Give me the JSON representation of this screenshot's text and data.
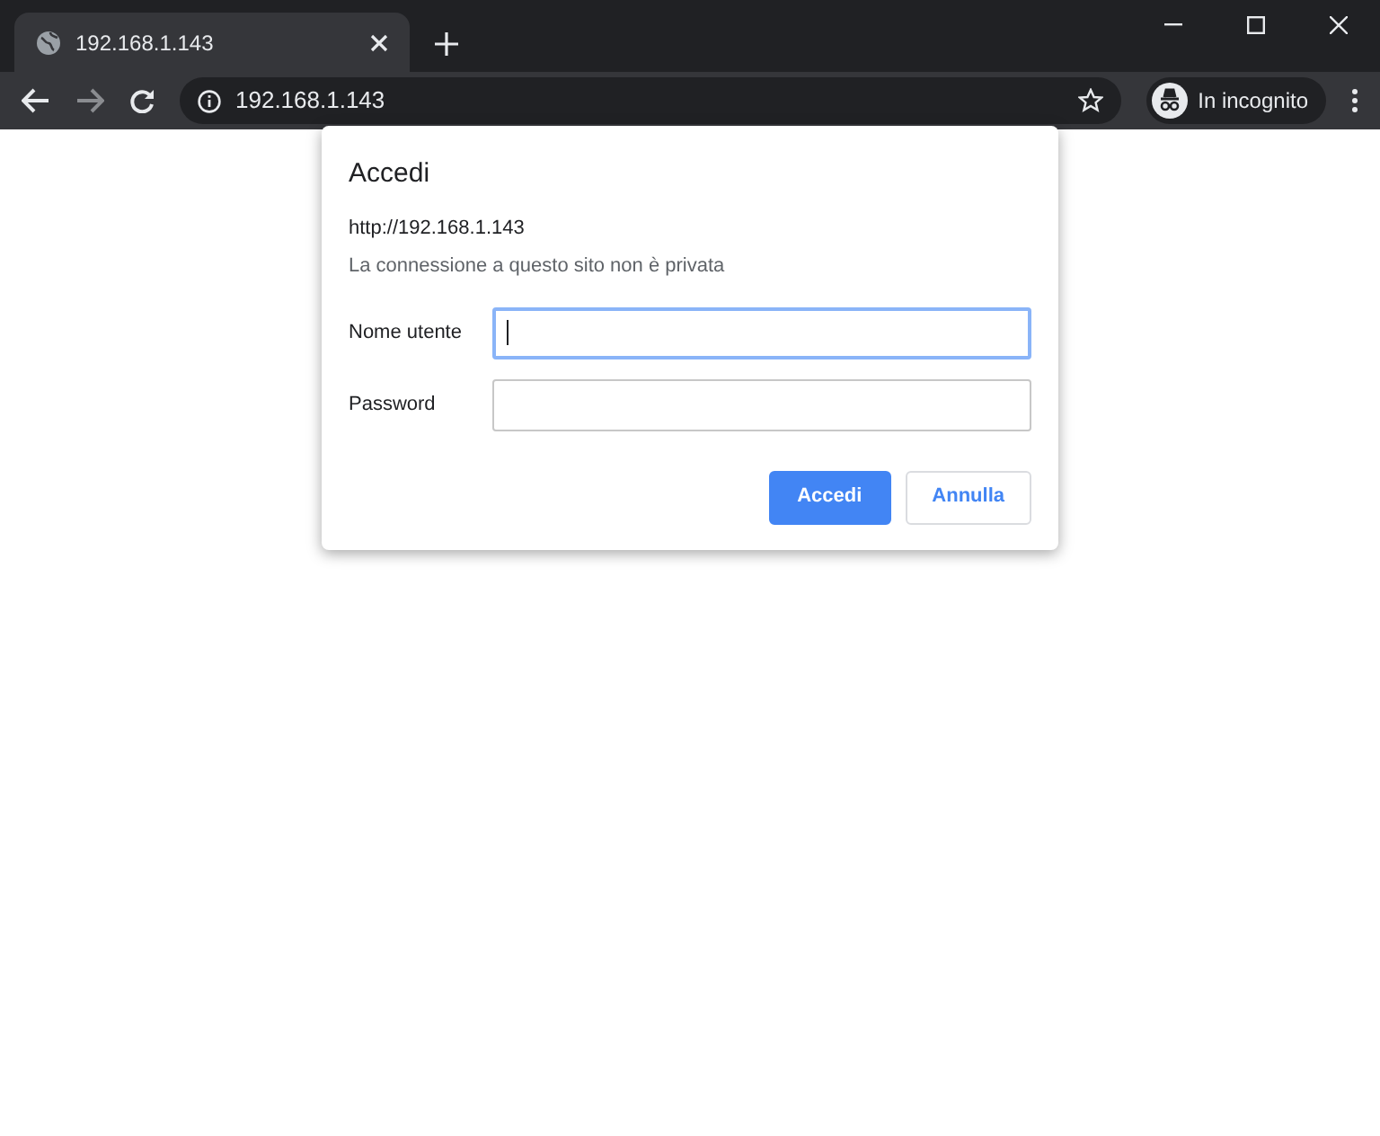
{
  "tab": {
    "title": "192.168.1.143",
    "selected": true
  },
  "address_bar": {
    "url": "192.168.1.143"
  },
  "profile": {
    "label": "In incognito"
  },
  "dialog": {
    "title": "Accedi",
    "origin": "http://192.168.1.143",
    "warning": "La connessione a questo sito non è privata",
    "fields": [
      {
        "label": "Nome utente",
        "focused": true
      },
      {
        "label": "Password",
        "focused": false
      }
    ],
    "buttons": [
      {
        "label": "Accedi",
        "kind": "primary"
      },
      {
        "label": "Annulla",
        "kind": "secondary"
      }
    ]
  }
}
